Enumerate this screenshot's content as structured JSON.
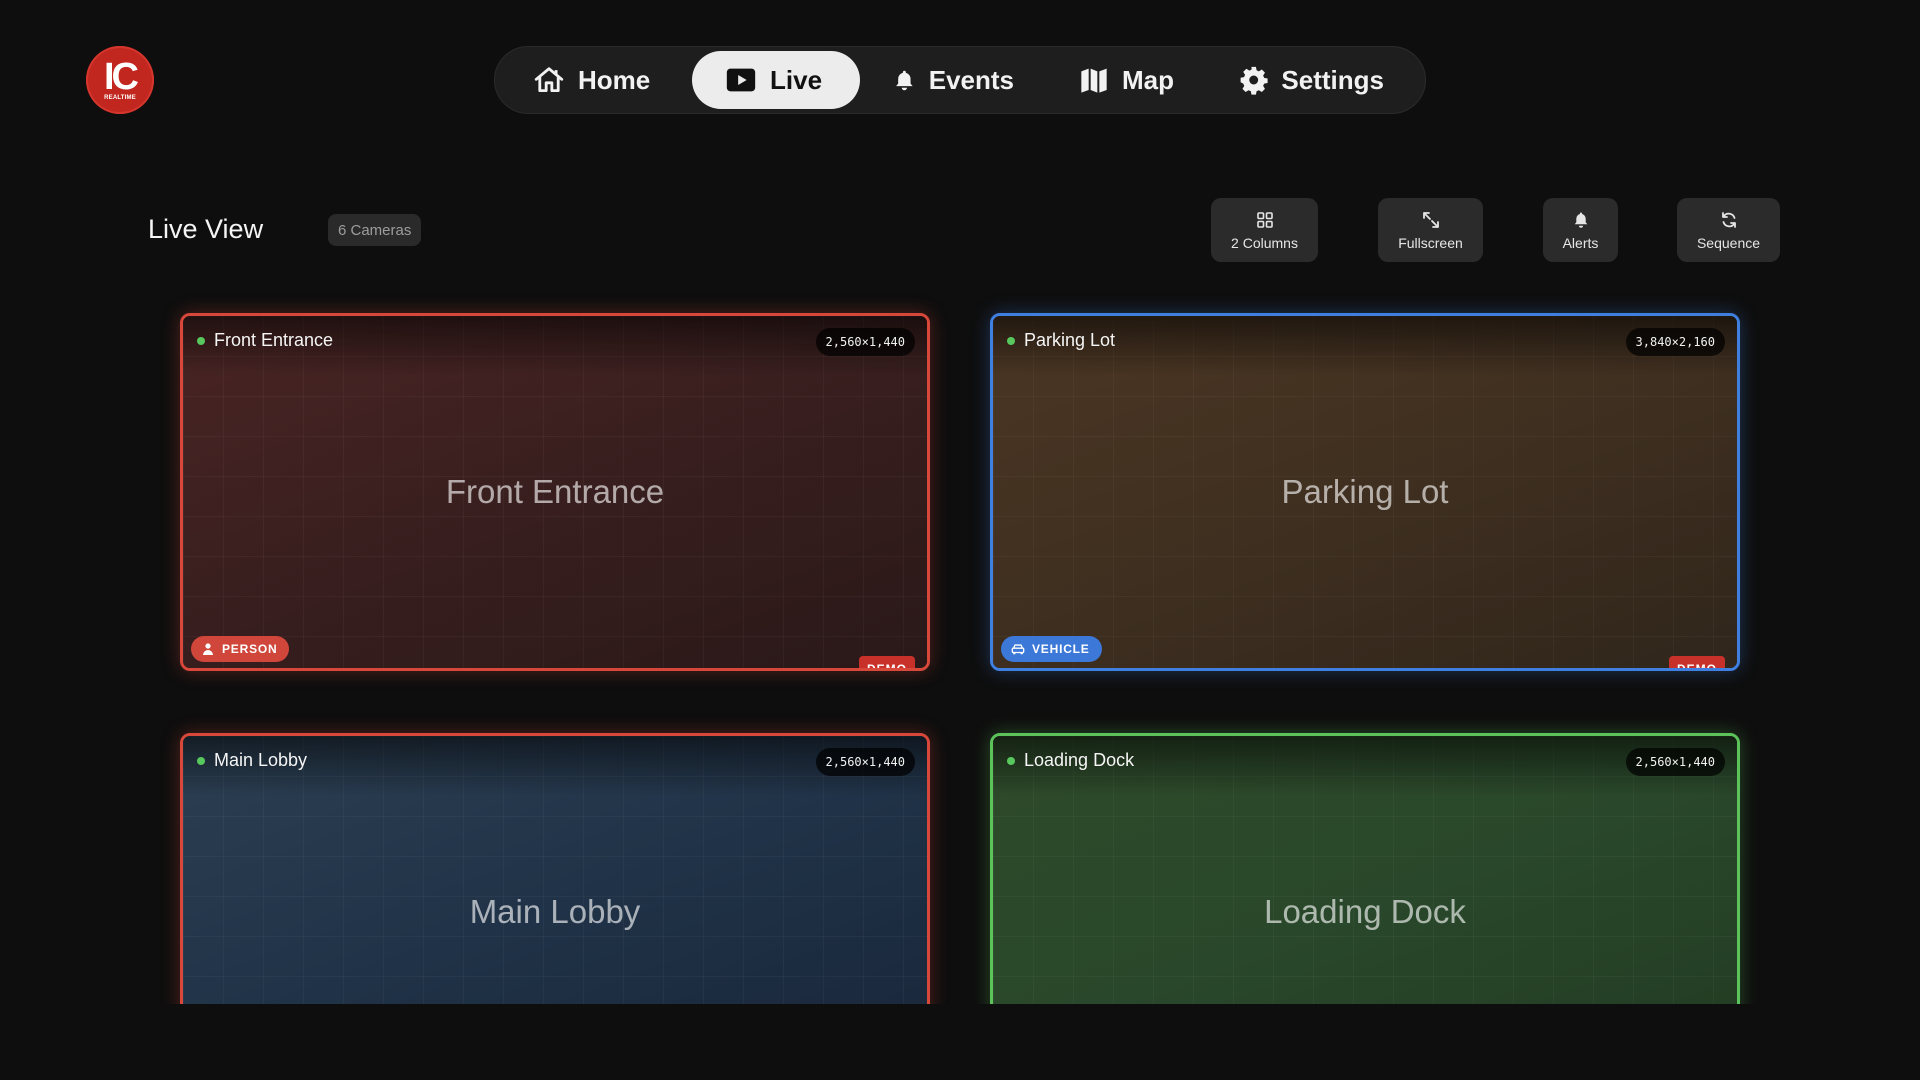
{
  "brand": {
    "logo_mark": "IC",
    "logo_sub": "REALTIME"
  },
  "nav": {
    "items": [
      {
        "label": "Home",
        "icon": "home-icon",
        "active": false
      },
      {
        "label": "Live",
        "icon": "play-icon",
        "active": true
      },
      {
        "label": "Events",
        "icon": "bell-icon",
        "active": false
      },
      {
        "label": "Map",
        "icon": "map-icon",
        "active": false
      },
      {
        "label": "Settings",
        "icon": "gear-icon",
        "active": false
      }
    ]
  },
  "header": {
    "title": "Live View",
    "camera_count": "6 Cameras"
  },
  "toolbar": {
    "columns_label": "2 Columns",
    "fullscreen_label": "Fullscreen",
    "alerts_label": "Alerts",
    "sequence_label": "Sequence"
  },
  "cameras": [
    {
      "name": "Front Entrance",
      "resolution": "2,560×1,440",
      "status": "online",
      "detection": "PERSON",
      "border_color": "#d8483a",
      "demo_label": "DEMO"
    },
    {
      "name": "Parking Lot",
      "resolution": "3,840×2,160",
      "status": "online",
      "detection": "VEHICLE",
      "border_color": "#3f7fe0",
      "demo_label": "DEMO"
    },
    {
      "name": "Main Lobby",
      "resolution": "2,560×1,440",
      "status": "online",
      "detection": "",
      "border_color": "#d8483a"
    },
    {
      "name": "Loading Dock",
      "resolution": "2,560×1,440",
      "status": "online",
      "detection": "",
      "border_color": "#5cc35a"
    }
  ],
  "colors": {
    "accent_red": "#c1271f",
    "status_online": "#57c75e",
    "person_tag": "#d0463a",
    "vehicle_tag": "#3b78d8"
  }
}
